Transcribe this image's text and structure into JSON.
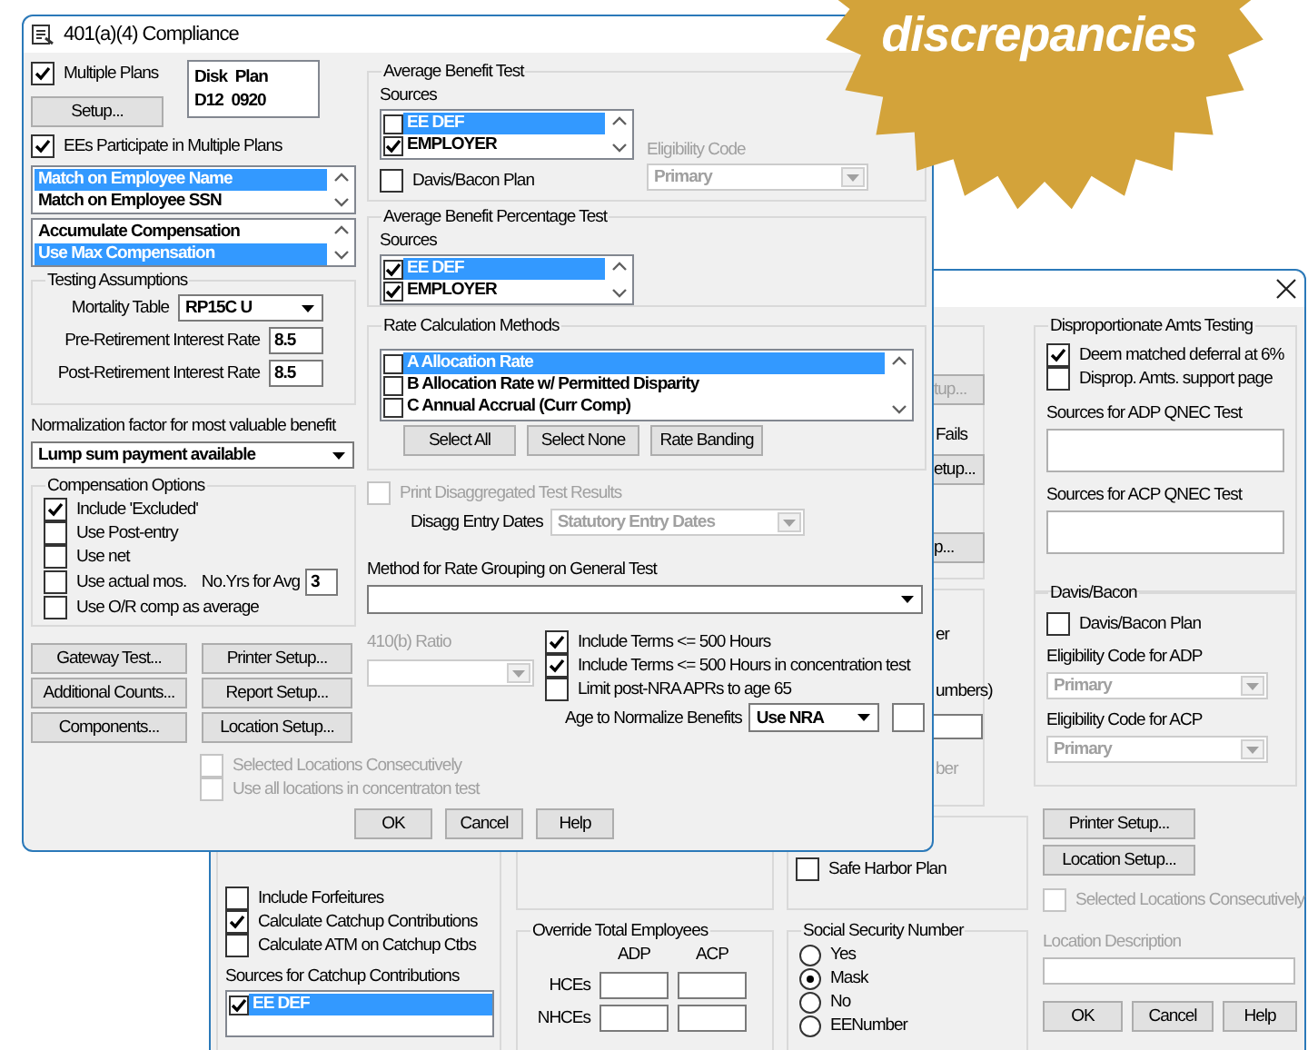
{
  "badge": {
    "text": "discrepancies"
  },
  "front_dialog": {
    "title": "401(a)(4) Compliance",
    "multiple_plans": {
      "label": "Multiple Plans",
      "checked": true
    },
    "plan_box": {
      "lines": [
        "Disk  Plan",
        "D12  0920"
      ]
    },
    "setup_button": "Setup...",
    "ees_participate": {
      "label": "EEs Participate in Multiple Plans",
      "checked": true
    },
    "match_list": [
      {
        "label": "Match on Employee Name",
        "selected": true
      },
      {
        "label": "Match on Employee SSN",
        "selected": false
      }
    ],
    "compensation_list": [
      {
        "label": "Accumulate Compensation",
        "selected": false
      },
      {
        "label": "Use Max Compensation",
        "selected": true
      }
    ],
    "testing_assumptions": {
      "title": "Testing Assumptions",
      "fields": [
        {
          "kind": "dropdown",
          "label": "Mortality Table",
          "value": "RP15C U"
        },
        {
          "kind": "text",
          "label": "Pre-Retirement Interest Rate",
          "value": "8.5"
        },
        {
          "kind": "text",
          "label": "Post-Retirement Interest Rate",
          "value": "8.5"
        }
      ]
    },
    "normalization": {
      "label": "Normalization factor for most valuable benefit",
      "value": "Lump sum payment available"
    },
    "compensation_options": {
      "title": "Compensation Options",
      "options": [
        {
          "label": "Include 'Excluded'",
          "checked": true
        },
        {
          "label": "Use Post-entry",
          "checked": false
        },
        {
          "label": "Use net",
          "checked": false
        },
        {
          "label": "Use actual mos.",
          "checked": false
        },
        {
          "label": "Use O/R comp as average",
          "checked": false
        }
      ],
      "years": {
        "label": "No.Yrs for Avg",
        "value": "3"
      }
    },
    "left_buttons": [
      "Gateway Test...",
      "Printer Setup...",
      "Additional Counts...",
      "Report Setup...",
      "Components...",
      "Location Setup..."
    ],
    "location_options": [
      {
        "label": "Selected Locations Consecutively",
        "checked": false,
        "disabled": true
      },
      {
        "label": "Use all locations in concentraton test",
        "checked": false,
        "disabled": true
      }
    ],
    "average_benefit_test": {
      "title": "Average Benefit Test",
      "sources_label": "Sources",
      "sources": [
        {
          "label": "EE DEF",
          "checked": false,
          "selected": true
        },
        {
          "label": "EMPLOYER",
          "checked": true,
          "selected": false
        }
      ],
      "davis_bacon": {
        "label": "Davis/Bacon Plan",
        "checked": false
      },
      "eligibility": {
        "label": "Eligibility Code",
        "value": "Primary",
        "disabled": true
      }
    },
    "average_benefit_percentage_test": {
      "title": "Average Benefit Percentage Test",
      "sources_label": "Sources",
      "sources": [
        {
          "label": "EE DEF",
          "checked": true,
          "selected": true
        },
        {
          "label": "EMPLOYER",
          "checked": true,
          "selected": false
        }
      ]
    },
    "rate_calculation": {
      "title": "Rate Calculation Methods",
      "methods": [
        {
          "label": "A Allocation Rate",
          "checked": false,
          "selected": true
        },
        {
          "label": "B Allocation Rate w/ Permitted Disparity",
          "checked": false,
          "selected": false
        },
        {
          "label": "C Annual Accrual (Curr Comp)",
          "checked": false,
          "selected": false
        }
      ],
      "buttons": [
        "Select All",
        "Select None",
        "Rate Banding"
      ]
    },
    "print_disaggregated": {
      "label": "Print Disaggregated Test Results",
      "checked": false,
      "disabled": true
    },
    "disagg_entry_dates": {
      "label": "Disagg Entry Dates",
      "value": "Statutory Entry Dates",
      "disabled": true
    },
    "rate_grouping": {
      "label": "Method for Rate Grouping on General Test"
    },
    "ratio_410b": {
      "label": "410(b) Ratio",
      "disabled": true
    },
    "terms_options": [
      {
        "label": "Include Terms <= 500 Hours",
        "checked": true
      },
      {
        "label": "Include Terms <= 500 Hours in concentration test",
        "checked": true
      },
      {
        "label": "Limit post-NRA APRs to age 65",
        "checked": false
      }
    ],
    "age_normalize": {
      "label": "Age to Normalize Benefits",
      "value": "Use NRA"
    },
    "buttons": [
      "OK",
      "Cancel",
      "Help"
    ]
  },
  "back_dialog": {
    "fragments": [
      {
        "kind": "button",
        "text": "tup...",
        "disabled": true
      },
      {
        "kind": "text",
        "text": "Fails",
        "disabled": false
      },
      {
        "kind": "button",
        "text": "etup...",
        "disabled": false
      },
      {
        "kind": "button",
        "text": "p...",
        "disabled": false
      },
      {
        "kind": "text",
        "text": "er",
        "disabled": false
      },
      {
        "kind": "text",
        "text": "umbers)",
        "disabled": false
      },
      {
        "kind": "field",
        "disabled": false
      },
      {
        "kind": "text",
        "text": "ber",
        "disabled": true
      }
    ],
    "catchup": {
      "options": [
        {
          "label": "Include Forfeitures",
          "checked": false
        },
        {
          "label": "Calculate Catchup Contributions",
          "checked": true
        },
        {
          "label": "Calculate ATM on Catchup Ctbs",
          "checked": false
        }
      ],
      "sources_label": "Sources for Catchup Contributions",
      "sources": [
        {
          "label": "EE DEF",
          "checked": true,
          "selected": true
        }
      ]
    },
    "safe_harbor": {
      "label": "Safe Harbor Plan",
      "checked": false
    },
    "override_total": {
      "title": "Override Total Employees",
      "columns": [
        "ADP",
        "ACP"
      ],
      "rows": [
        "HCEs",
        "NHCEs"
      ]
    },
    "ssn": {
      "title": "Social Security Number",
      "options": [
        {
          "label": "Yes",
          "selected": false
        },
        {
          "label": "Mask",
          "selected": true
        },
        {
          "label": "No",
          "selected": false
        },
        {
          "label": "EENumber",
          "selected": false
        }
      ]
    },
    "disproportionate": {
      "title": "Disproportionate Amts Testing",
      "options": [
        {
          "label": "Deem matched deferral at 6%",
          "checked": true
        },
        {
          "label": "Disprop. Amts. support page",
          "checked": false
        }
      ],
      "qnec": [
        "Sources for ADP QNEC Test",
        "Sources for ACP QNEC Test"
      ]
    },
    "davis_bacon": {
      "title": "Davis/Bacon",
      "plan": {
        "label": "Davis/Bacon Plan",
        "checked": false
      },
      "codes": [
        {
          "label": "Eligibility Code for ADP",
          "value": "Primary",
          "disabled": true
        },
        {
          "label": "Eligibility Code for ACP",
          "value": "Primary",
          "disabled": true
        }
      ]
    },
    "setup_buttons": [
      "Printer Setup...",
      "Location Setup..."
    ],
    "selected_locations": {
      "label": "Selected Locations Consecutively",
      "checked": false,
      "disabled": true
    },
    "location_description": {
      "label": "Location Description",
      "disabled": true
    },
    "buttons": [
      "OK",
      "Cancel",
      "Help"
    ]
  }
}
